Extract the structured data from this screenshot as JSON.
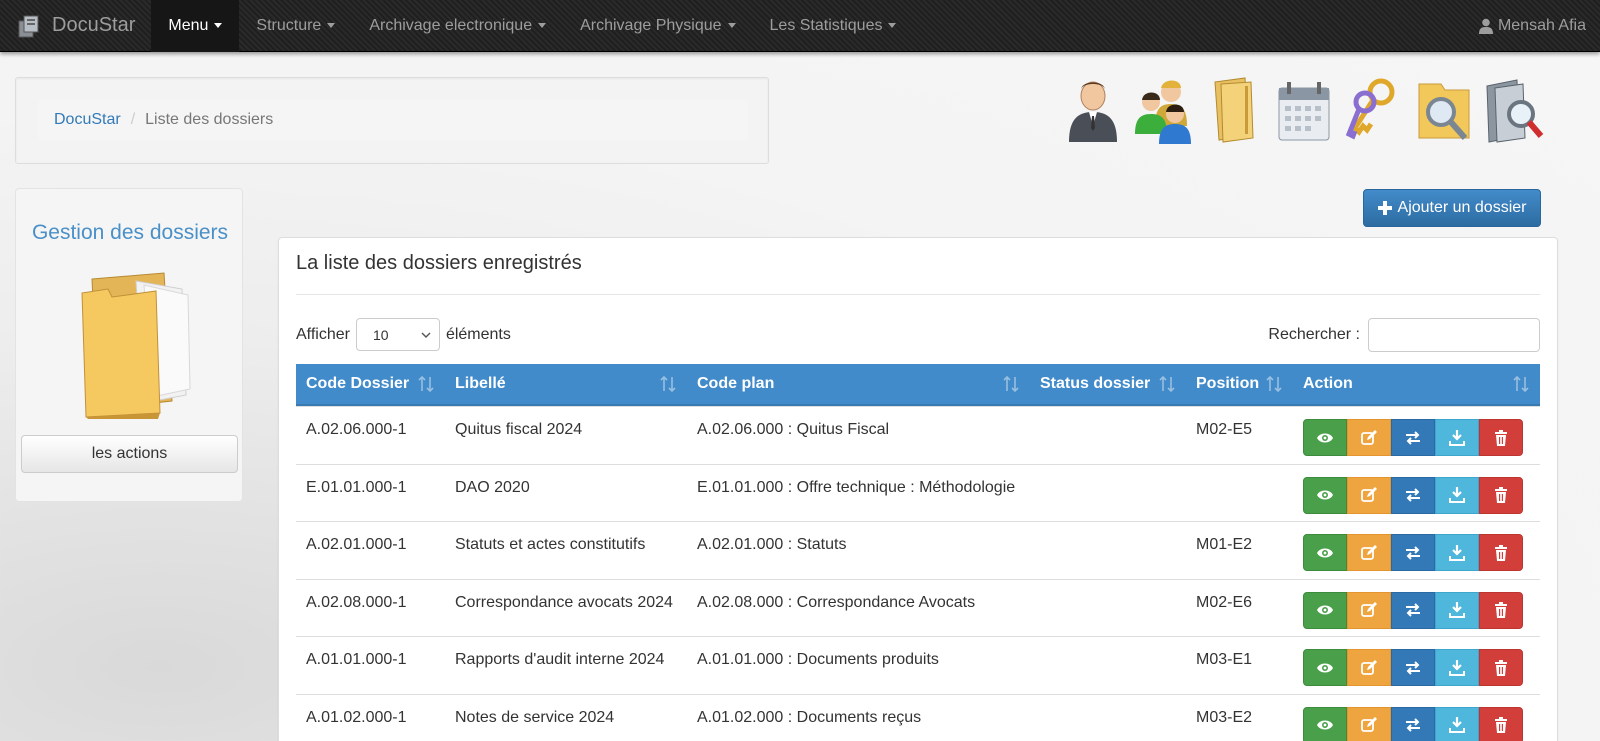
{
  "navbar": {
    "brand": "DocuStar",
    "items": [
      {
        "label": "Menu",
        "active": true
      },
      {
        "label": "Structure",
        "active": false
      },
      {
        "label": "Archivage electronique",
        "active": false
      },
      {
        "label": "Archivage Physique",
        "active": false
      },
      {
        "label": "Les Statistiques",
        "active": false
      }
    ],
    "user": "Mensah Afia"
  },
  "breadcrumb": {
    "root": "DocuStar",
    "separator": "/",
    "current": "Liste des dossiers"
  },
  "top_icons": [
    "user-icon",
    "users-group-icon",
    "folder-icon",
    "calendar-icon",
    "keys-icon",
    "folder-search-icon",
    "document-search-icon"
  ],
  "sidebar": {
    "title": "Gestion des dossiers",
    "actions_button": "les actions"
  },
  "add_button": "Ajouter un dossier",
  "panel": {
    "title": "La liste des dossiers enregistrés",
    "show_label": "Afficher",
    "show_value": "10",
    "show_suffix": "éléments",
    "search_label": "Rechercher :"
  },
  "table": {
    "columns": [
      "Code Dossier",
      "Libellé",
      "Code plan",
      "Status dossier",
      "Position",
      "Action"
    ],
    "rows": [
      {
        "code": "A.02.06.000-1",
        "libelle": "Quitus fiscal 2024",
        "plan": "A.02.06.000 : Quitus Fiscal",
        "status": "",
        "position": "M02-E5"
      },
      {
        "code": "E.01.01.000-1",
        "libelle": "DAO 2020",
        "plan": "E.01.01.000 : Offre technique : Méthodologie",
        "status": "",
        "position": ""
      },
      {
        "code": "A.02.01.000-1",
        "libelle": "Statuts et actes constitutifs",
        "plan": "A.02.01.000 : Statuts",
        "status": "",
        "position": "M01-E2"
      },
      {
        "code": "A.02.08.000-1",
        "libelle": "Correspondance avocats 2024",
        "plan": "A.02.08.000 : Correspondance Avocats",
        "status": "",
        "position": "M02-E6"
      },
      {
        "code": "A.01.01.000-1",
        "libelle": "Rapports d'audit interne 2024",
        "plan": "A.01.01.000 : Documents produits",
        "status": "",
        "position": "M03-E1"
      },
      {
        "code": "A.01.02.000-1",
        "libelle": "Notes de service 2024",
        "plan": "A.01.02.000 : Documents reçus",
        "status": "",
        "position": "M03-E2"
      }
    ],
    "action_icons": [
      "eye-icon",
      "edit-icon",
      "transfer-icon",
      "download-icon",
      "trash-icon"
    ]
  },
  "colors": {
    "header_blue": "#428bca",
    "view_green": "#4aa04a",
    "edit_orange": "#efa53f",
    "move_blue": "#3379b7",
    "download_cyan": "#4fb6dc",
    "delete_red": "#d23f3a",
    "sidebar_title": "#4a90c8"
  }
}
